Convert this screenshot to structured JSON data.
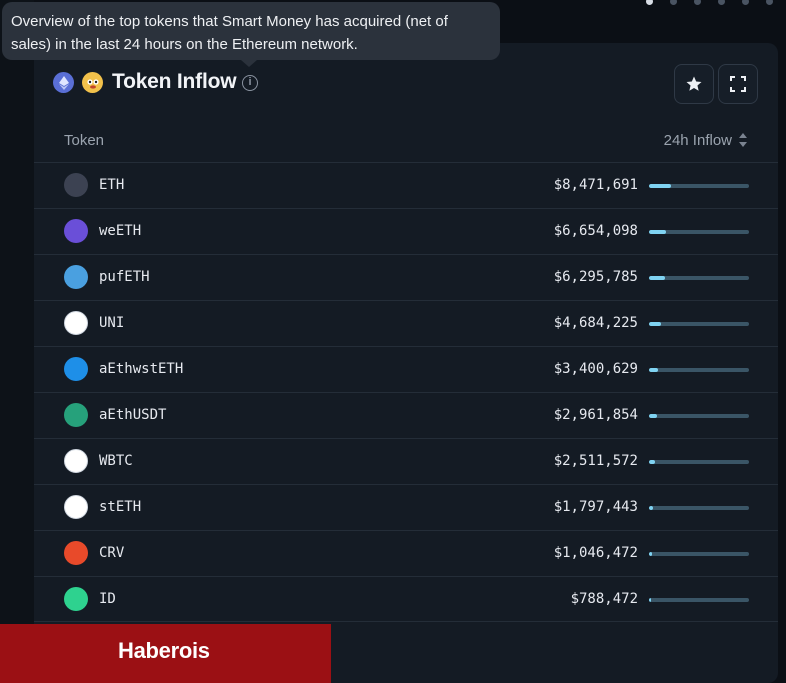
{
  "tooltip": {
    "text": "Overview of the top tokens that Smart Money has acquired (net of sales) in the last 24 hours on the Ethereum network."
  },
  "header": {
    "title": "Token Inflow",
    "icons": [
      "ethereum-icon",
      "emoji-icon",
      "info-icon"
    ],
    "buttons": [
      "star-icon",
      "expand-icon"
    ]
  },
  "table": {
    "columns": [
      "Token",
      "24h Inflow"
    ],
    "rows": [
      {
        "token": "ETH",
        "inflow": "$8,471,691",
        "share": 0.22,
        "icon": "eth-token-icon",
        "color": "#3c4252"
      },
      {
        "token": "weETH",
        "inflow": "$6,654,098",
        "share": 0.17,
        "icon": "weeth-token-icon",
        "color": "#6a4fd8"
      },
      {
        "token": "pufETH",
        "inflow": "$6,295,785",
        "share": 0.16,
        "icon": "pufeth-token-icon",
        "color": "#4aa0e0"
      },
      {
        "token": "UNI",
        "inflow": "$4,684,225",
        "share": 0.12,
        "icon": "uni-token-icon",
        "color": "#ffffff"
      },
      {
        "token": "aEthwstETH",
        "inflow": "$3,400,629",
        "share": 0.09,
        "icon": "aethwsteth-token-icon",
        "color": "#1e8fe8"
      },
      {
        "token": "aEthUSDT",
        "inflow": "$2,961,854",
        "share": 0.08,
        "icon": "aethusdt-token-icon",
        "color": "#26a17b"
      },
      {
        "token": "WBTC",
        "inflow": "$2,511,572",
        "share": 0.06,
        "icon": "wbtc-token-icon",
        "color": "#ffffff"
      },
      {
        "token": "stETH",
        "inflow": "$1,797,443",
        "share": 0.04,
        "icon": "steth-token-icon",
        "color": "#ffffff"
      },
      {
        "token": "CRV",
        "inflow": "$1,046,472",
        "share": 0.025,
        "icon": "crv-token-icon",
        "color": "#e84a2a"
      },
      {
        "token": "ID",
        "inflow": "$788,472",
        "share": 0.02,
        "icon": "id-token-icon",
        "color": "#2ed28f"
      }
    ]
  },
  "pager": [
    "first-page-icon",
    "prev-page-icon",
    "next-page-icon",
    "last-page-icon"
  ],
  "banner": {
    "text": "Haberois"
  },
  "colors": {
    "bar_track": "#3a5566",
    "bar_fill": "#7fd3f2",
    "banner": "#9b1014"
  }
}
